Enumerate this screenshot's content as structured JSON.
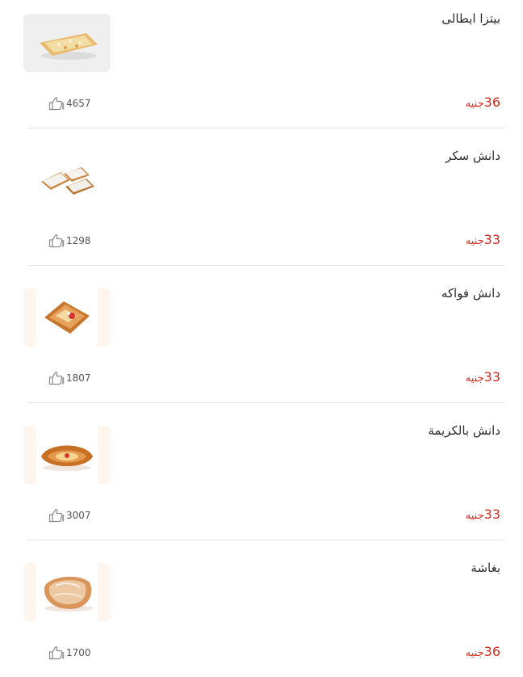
{
  "menu": {
    "items": [
      {
        "name": "بيتزا ايطالى",
        "price": "36",
        "currency": "جنيه",
        "likes": "4657",
        "image": "italian-pizza-image"
      },
      {
        "name": "دانش سكر",
        "price": "33",
        "currency": "جنيه",
        "likes": "1298",
        "image": "sugar-danish-image"
      },
      {
        "name": "دانش فواكه",
        "price": "33",
        "currency": "جنيه",
        "likes": "1807",
        "image": "fruit-danish-image"
      },
      {
        "name": "دانش بالكريمة",
        "price": "33",
        "currency": "جنيه",
        "likes": "3007",
        "image": "cream-danish-image"
      },
      {
        "name": "بغاشة",
        "price": "36",
        "currency": "جنيه",
        "likes": "1700",
        "image": "baghasha-image"
      }
    ]
  },
  "colors": {
    "price": "#d52b1e",
    "divider": "#e3e3e3",
    "text": "#2b2b2b"
  }
}
